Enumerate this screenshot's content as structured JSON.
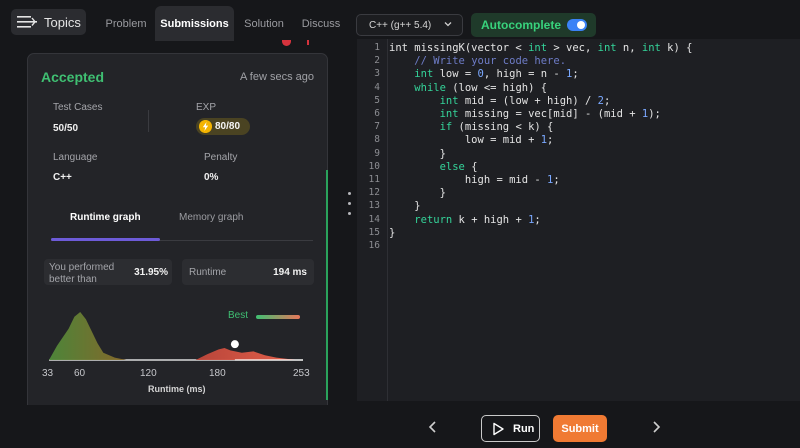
{
  "header": {
    "topics_label": "Topics",
    "tabs": [
      {
        "label": "Problem"
      },
      {
        "label": "Submissions"
      },
      {
        "label": "Solution"
      },
      {
        "label": "Discuss"
      }
    ],
    "language": "C++ (g++ 5.4)",
    "autocomplete_label": "Autocomplete",
    "autocomplete_on": true
  },
  "result": {
    "status": "Accepted",
    "time_ago": "A few secs ago",
    "test_cases_label": "Test Cases",
    "test_cases_value": "50/50",
    "exp_label": "EXP",
    "exp_value": "80/80",
    "language_label": "Language",
    "language_value": "C++",
    "penalty_label": "Penalty",
    "penalty_value": "0%",
    "graph_tabs": [
      "Runtime graph",
      "Memory graph"
    ],
    "performed_label": "You performed better than",
    "performed_value": "31.95%",
    "runtime_label": "Runtime",
    "runtime_value": "194 ms",
    "best_label": "Best"
  },
  "chart_data": {
    "type": "area",
    "xlabel": "Runtime (ms)",
    "x_ticks": [
      33,
      60,
      120,
      180,
      253
    ],
    "xlim": [
      33,
      253
    ],
    "series": [
      {
        "color": "#5d7a30",
        "x": [
          33,
          40,
          50,
          55,
          60,
          65,
          70,
          75,
          80,
          90,
          100
        ],
        "y": [
          0,
          0.3,
          0.65,
          0.9,
          1.0,
          0.85,
          0.6,
          0.35,
          0.15,
          0.05,
          0
        ]
      },
      {
        "color": "#e8604c",
        "x": [
          160,
          170,
          180,
          185,
          190,
          200,
          210,
          220,
          230,
          240,
          253
        ],
        "y": [
          0,
          0.12,
          0.22,
          0.25,
          0.2,
          0.15,
          0.18,
          0.1,
          0.05,
          0.02,
          0
        ]
      }
    ],
    "marker_x": 194
  },
  "editor": {
    "lines": [
      "int missingK(vector < int > vec, int n, int k) {",
      "    // Write your code here.",
      "    int low = 0, high = n - 1;",
      "    while (low <= high) {",
      "        int mid = (low + high) / 2;",
      "        int missing = vec[mid] - (mid + 1);",
      "        if (missing < k) {",
      "            low = mid + 1;",
      "        }",
      "        else {",
      "            high = mid - 1;",
      "        }",
      "    }",
      "    return k + high + 1;",
      "}",
      ""
    ]
  },
  "footer": {
    "run_label": "Run",
    "submit_label": "Submit"
  },
  "colors": {
    "accent_green": "#3fbf72",
    "submit_orange": "#f07a33",
    "tab_underline": "#6d5bd8"
  }
}
